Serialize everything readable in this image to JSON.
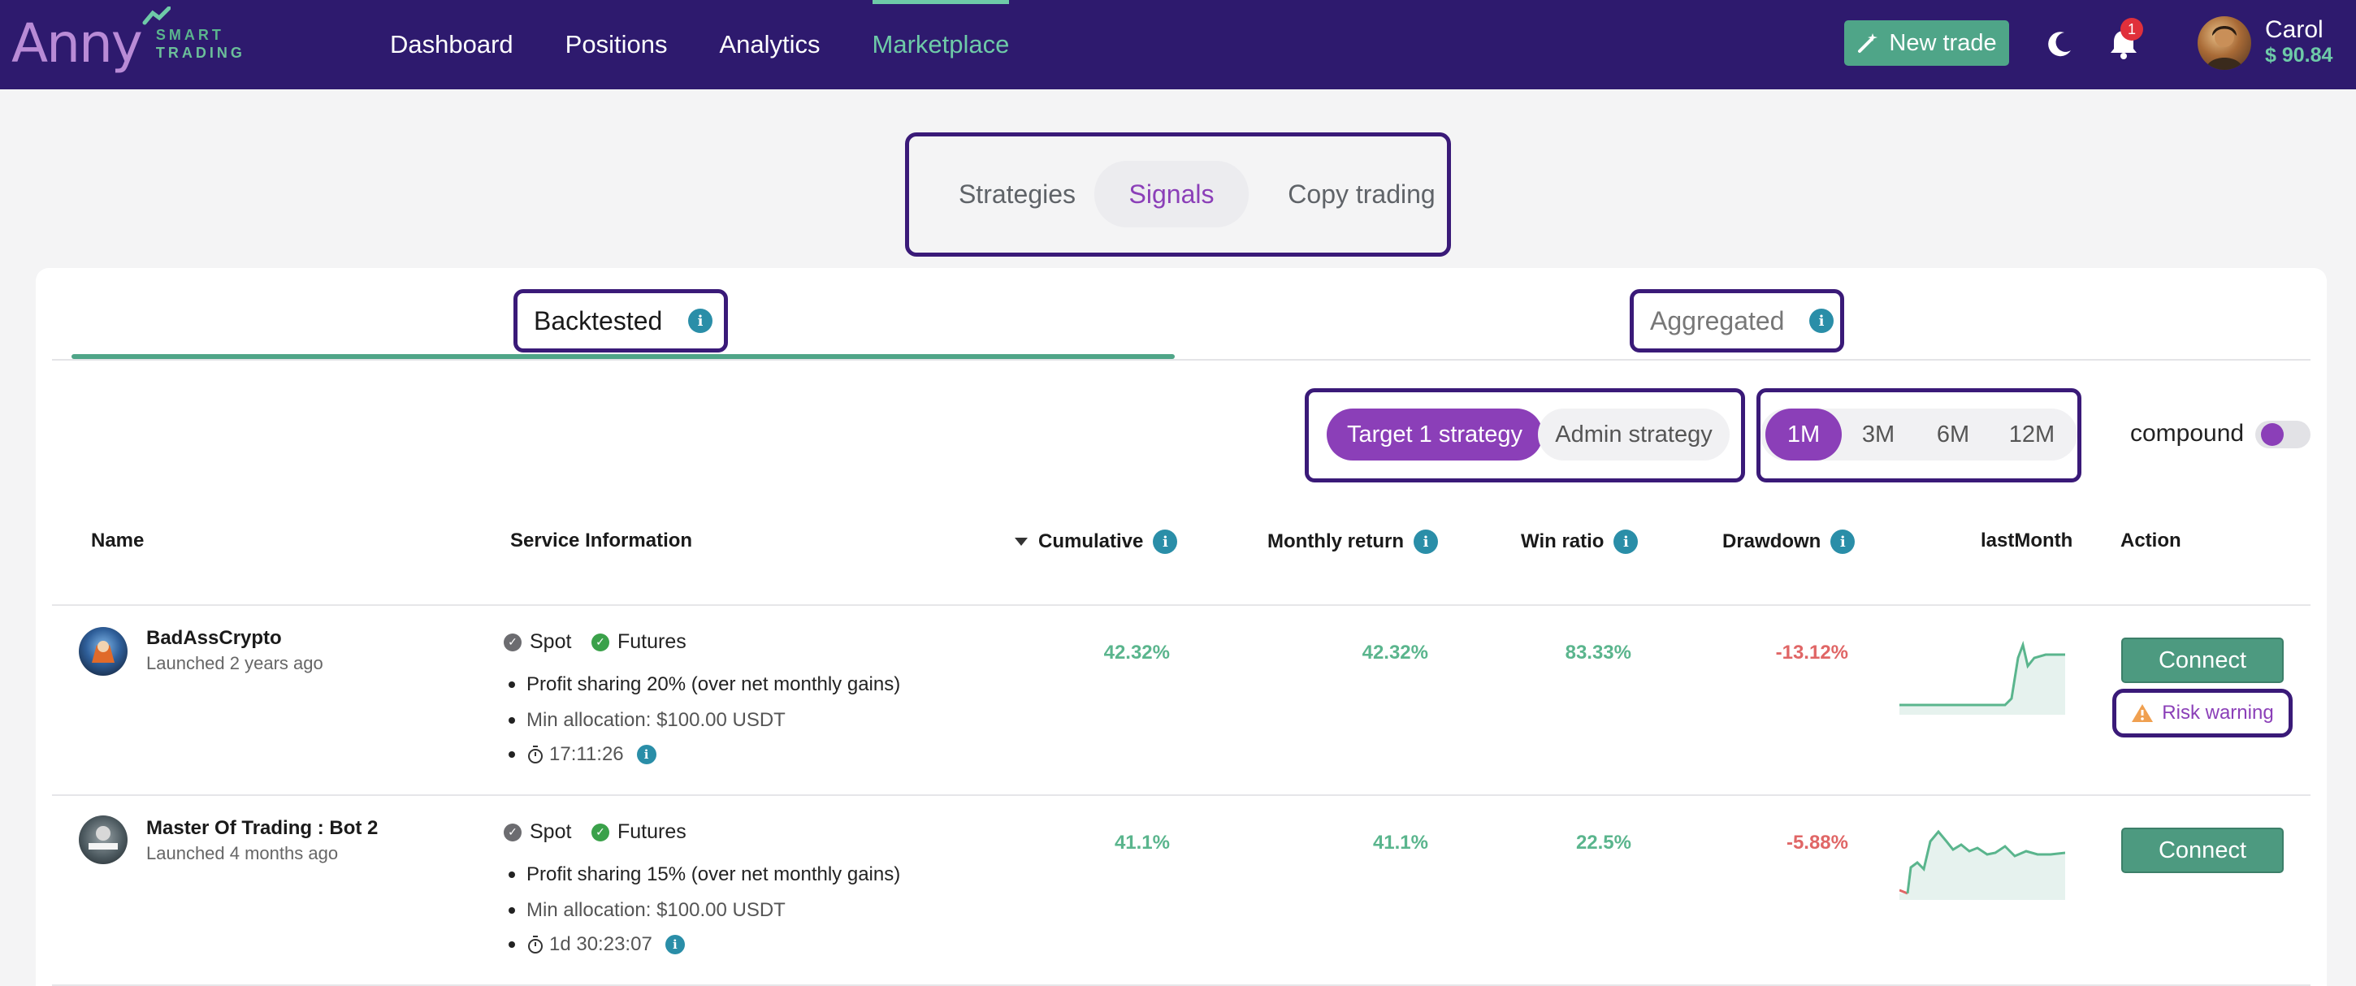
{
  "navbar": {
    "logo_word": "Anny",
    "logo_sub_top": "SMART",
    "logo_sub_bottom": "TRADING",
    "links": [
      "Dashboard",
      "Positions",
      "Analytics",
      "Marketplace"
    ],
    "active_link": "Marketplace",
    "new_trade_label": "New trade",
    "notifications_count": "1",
    "user_name": "Carol",
    "user_balance": "$ 90.84"
  },
  "top_tabs": [
    "Strategies",
    "Signals",
    "Copy trading"
  ],
  "top_tabs_active": "Signals",
  "sub_tabs": {
    "backtested": "Backtested",
    "aggregated": "Aggregated",
    "active": "Backtested"
  },
  "filters": {
    "strategy_options": [
      "Target 1 strategy",
      "Admin strategy"
    ],
    "strategy_active": "Target 1 strategy",
    "period_options": [
      "1M",
      "3M",
      "6M",
      "12M"
    ],
    "period_active": "1M",
    "compound_label": "compound",
    "compound_on": false
  },
  "table": {
    "headers": {
      "name": "Name",
      "service": "Service Information",
      "cumulative": "Cumulative",
      "monthly": "Monthly return",
      "win": "Win ratio",
      "drawdown": "Drawdown",
      "last_month": "lastMonth",
      "action": "Action"
    },
    "sorted_by": "Cumulative",
    "sort_direction": "desc",
    "rows": [
      {
        "name": "BadAssCrypto",
        "launched": "Launched 2 years ago",
        "tags": [
          "Spot",
          "Futures"
        ],
        "profit_sharing": "Profit sharing 20% (over net monthly gains)",
        "min_allocation": "Min allocation: $100.00 USDT",
        "timer": "17:11:26",
        "cumulative": "42.32%",
        "monthly_return": "42.32%",
        "win_ratio": "83.33%",
        "drawdown": "-13.12%",
        "action": "Connect",
        "risk_warning": "Risk warning"
      },
      {
        "name": "Master Of Trading : Bot 2",
        "launched": "Launched 4 months ago",
        "tags": [
          "Spot",
          "Futures"
        ],
        "profit_sharing": "Profit sharing 15% (over net monthly gains)",
        "min_allocation": "Min allocation: $100.00 USDT",
        "timer": "1d 30:23:07",
        "cumulative": "41.1%",
        "monthly_return": "41.1%",
        "win_ratio": "22.5%",
        "drawdown": "-5.88%",
        "action": "Connect"
      }
    ]
  },
  "colors": {
    "navbar": "#2e1a6e",
    "accent_green": "#4fa588",
    "accent_purple": "#8b3fb8",
    "positive": "#5ab58d",
    "negative": "#e06666",
    "highlight_border": "#3a1a78"
  }
}
